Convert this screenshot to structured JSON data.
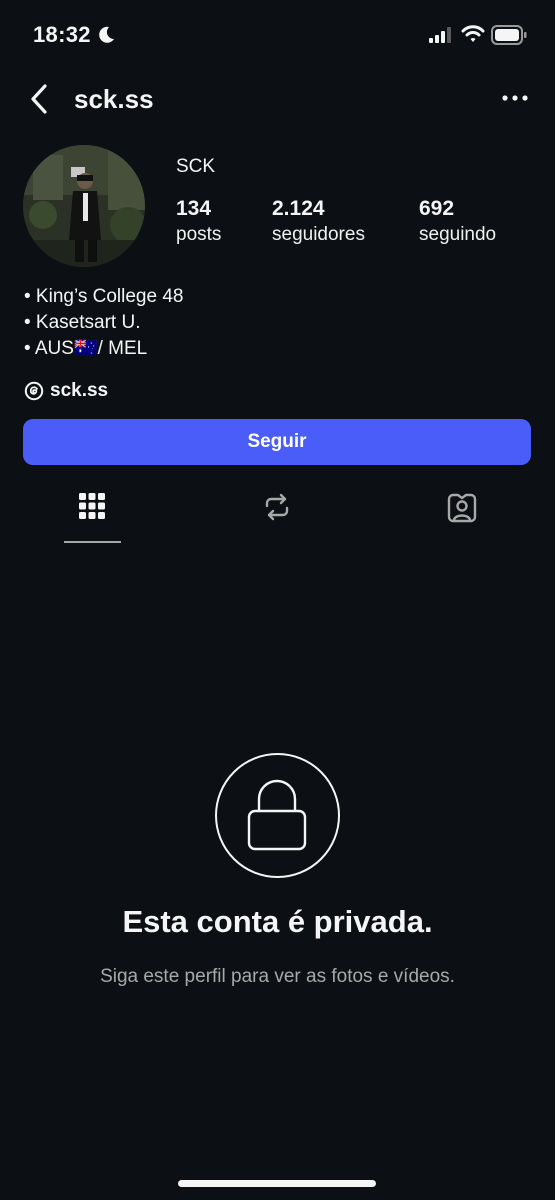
{
  "status_bar": {
    "time": "18:32",
    "icons": [
      "moon-icon",
      "signal-icon",
      "wifi-icon",
      "battery-icon"
    ]
  },
  "header": {
    "username": "sck.ss",
    "back_icon": "chevron-left-icon",
    "more_icon": "more-horizontal-icon"
  },
  "profile": {
    "display_name": "SCK",
    "stats": [
      {
        "value": "134",
        "label": "posts"
      },
      {
        "value": "2.124",
        "label": "seguidores"
      },
      {
        "value": "692",
        "label": "seguindo"
      }
    ],
    "bio": [
      "• King’s College 48",
      "• Kasetsart U.",
      "• AUS🇦🇺/ MEL"
    ],
    "threads_handle": "sck.ss"
  },
  "actions": {
    "follow_label": "Seguir"
  },
  "tabs": [
    {
      "icon": "grid-icon",
      "selected": true
    },
    {
      "icon": "repost-icon",
      "selected": false
    },
    {
      "icon": "tagged-icon",
      "selected": false
    }
  ],
  "private_notice": {
    "title": "Esta conta é privada.",
    "subtitle": "Siga este perfil para ver as fotos e vídeos."
  },
  "colors": {
    "background": "#0c1014",
    "accent": "#4a5df9",
    "text": "#f5f5f5",
    "secondary_text": "#a8a8a8"
  }
}
